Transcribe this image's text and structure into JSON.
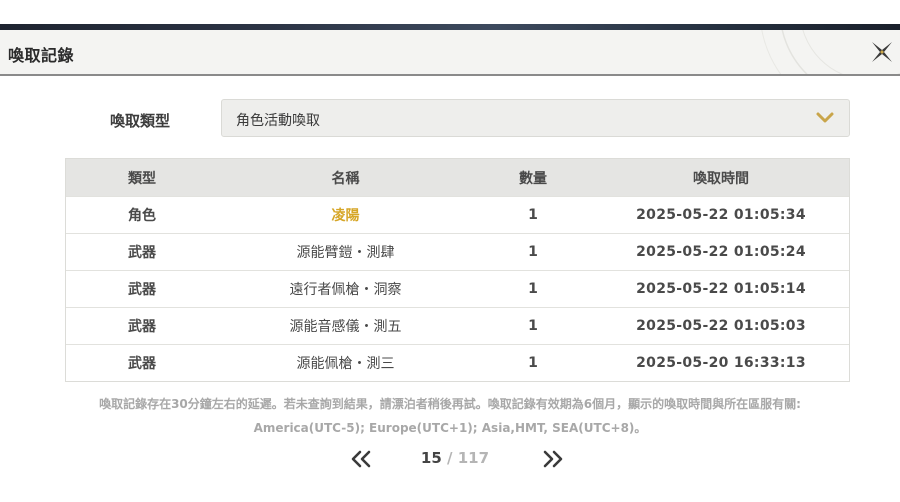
{
  "header": {
    "title": "喚取記錄"
  },
  "filter": {
    "label": "喚取類型",
    "selected": "角色活動喚取"
  },
  "table": {
    "columns": [
      "類型",
      "名稱",
      "數量",
      "喚取時間"
    ],
    "rows": [
      {
        "type": "角色",
        "name": "凌陽",
        "qty": "1",
        "time": "2025-05-22 01:05:34"
      },
      {
        "type": "武器",
        "name": "源能臂鎧・測肆",
        "qty": "1",
        "time": "2025-05-22 01:05:24"
      },
      {
        "type": "武器",
        "name": "遠行者佩槍・洞察",
        "qty": "1",
        "time": "2025-05-22 01:05:14"
      },
      {
        "type": "武器",
        "name": "源能音感儀・測五",
        "qty": "1",
        "time": "2025-05-22 01:05:03"
      },
      {
        "type": "武器",
        "name": "源能佩槍・測三",
        "qty": "1",
        "time": "2025-05-20 16:33:13"
      }
    ]
  },
  "notice": {
    "line1": "喚取記錄存在30分鐘左右的延遲。若未查詢到結果，請漂泊者稍後再試。喚取記錄有效期為6個月，顯示的喚取時間與所在區服有關:",
    "line2": "America(UTC-5); Europe(UTC+1); Asia,HMT, SEA(UTC+8)。"
  },
  "pagination": {
    "current": "15",
    "separator": "/",
    "total": "117"
  },
  "colors": {
    "gold_name": "#d6a627",
    "header_bg": "#f4f4f2",
    "table_head_bg": "#e5e5e3"
  },
  "icons": {
    "close": "close-x-icon",
    "dropdown": "chevron-down-icon",
    "prev": "double-chevron-left-icon",
    "next": "double-chevron-right-icon"
  }
}
